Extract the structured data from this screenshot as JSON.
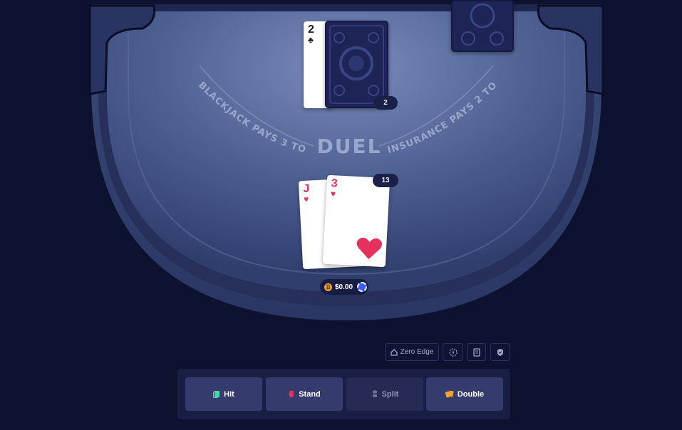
{
  "table": {
    "left_text": "BLACKJACK PAYS 3 TO 2",
    "center_text": "DUEL",
    "right_text": "INSURANCE PAYS 2 TO 1"
  },
  "dealer": {
    "up_card": {
      "rank": "2",
      "suit": "♣",
      "color": "#1a1a2e"
    },
    "hand_total": "2"
  },
  "player": {
    "cards": [
      {
        "rank": "J",
        "suit": "♥",
        "color": "#e5315c"
      },
      {
        "rank": "3",
        "suit": "♥",
        "color": "#e5315c"
      }
    ],
    "hand_total": "13",
    "bet": "$0.00"
  },
  "utilities": {
    "zero_edge_label": "Zero Edge",
    "zero_edge_icon": "house-icon",
    "fairness_icon": "spark-icon",
    "stats_icon": "document-icon",
    "security_icon": "shield-icon"
  },
  "actions": {
    "hit": {
      "label": "Hit",
      "icon": "card-icon",
      "icon_color": "#3ee0a0"
    },
    "stand": {
      "label": "Stand",
      "icon": "hand-icon",
      "icon_color": "#e5315c"
    },
    "split": {
      "label": "Split",
      "icon": "split-icon",
      "icon_color": "#6d7296"
    },
    "double": {
      "label": "Double",
      "icon": "double-cards-icon",
      "icon_color": "#f5a623"
    }
  },
  "colors": {
    "background": "#0e1231",
    "felt": "#4a5b8c",
    "heart": "#e5315c",
    "chip": "#3a5bff"
  }
}
